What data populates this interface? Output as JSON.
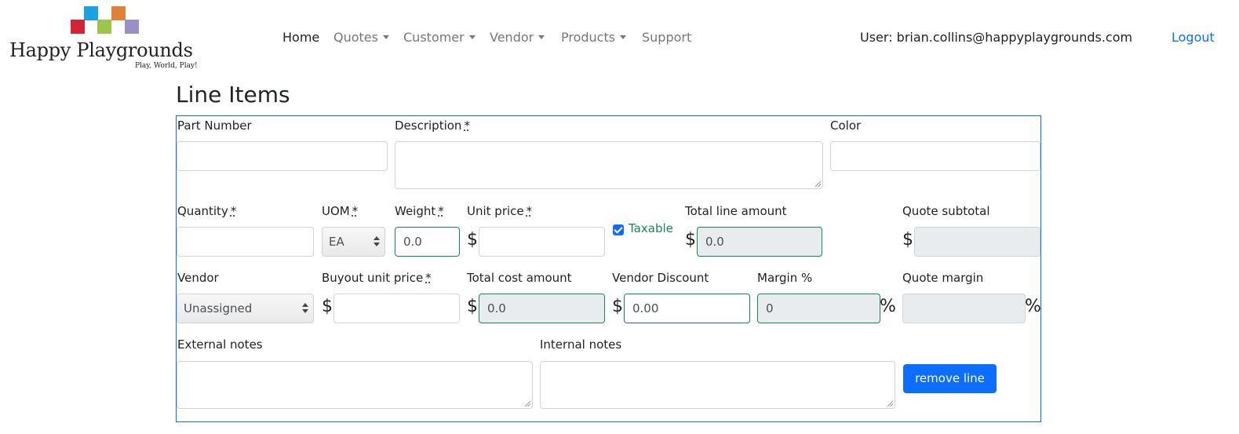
{
  "brand": {
    "name": "Happy Playgrounds",
    "tagline": "Play, World, Play!"
  },
  "nav": {
    "home": "Home",
    "quotes": "Quotes",
    "customer": "Customer",
    "vendor": "Vendor",
    "products": "Products",
    "support": "Support"
  },
  "user": {
    "label": "User: brian.collins@happyplaygrounds.com",
    "logout": "Logout"
  },
  "page": {
    "title": "Line Items"
  },
  "form": {
    "part_number": {
      "label": "Part Number",
      "value": ""
    },
    "description": {
      "label": "Description",
      "req": "*",
      "value": ""
    },
    "color": {
      "label": "Color",
      "value": ""
    },
    "quantity": {
      "label": "Quantity",
      "req": "*",
      "value": ""
    },
    "uom": {
      "label": "UOM",
      "req": "*",
      "value": "EA"
    },
    "weight": {
      "label": "Weight",
      "req": "*",
      "value": "0.0"
    },
    "unit_price": {
      "label": "Unit price",
      "req": "*",
      "currency": "$",
      "value": ""
    },
    "taxable": {
      "label": "Taxable",
      "checked": true
    },
    "total_line_amount": {
      "label": "Total line amount",
      "currency": "$",
      "value": "0.0"
    },
    "quote_subtotal": {
      "label": "Quote subtotal",
      "currency": "$",
      "value": ""
    },
    "vendor": {
      "label": "Vendor",
      "value": "Unassigned"
    },
    "buyout_unit_price": {
      "label": "Buyout unit price",
      "req": "*",
      "currency": "$",
      "value": ""
    },
    "total_cost_amount": {
      "label": "Total cost amount",
      "currency": "$",
      "value": "0.0"
    },
    "vendor_discount": {
      "label": "Vendor Discount",
      "currency": "$",
      "value": "0.00"
    },
    "margin_pct": {
      "label": "Margin %",
      "value": "0",
      "unit": "%"
    },
    "quote_margin": {
      "label": "Quote margin",
      "value": "",
      "unit": "%"
    },
    "external_notes": {
      "label": "External notes",
      "value": ""
    },
    "internal_notes": {
      "label": "Internal notes",
      "value": ""
    },
    "remove_line": "remove line"
  }
}
